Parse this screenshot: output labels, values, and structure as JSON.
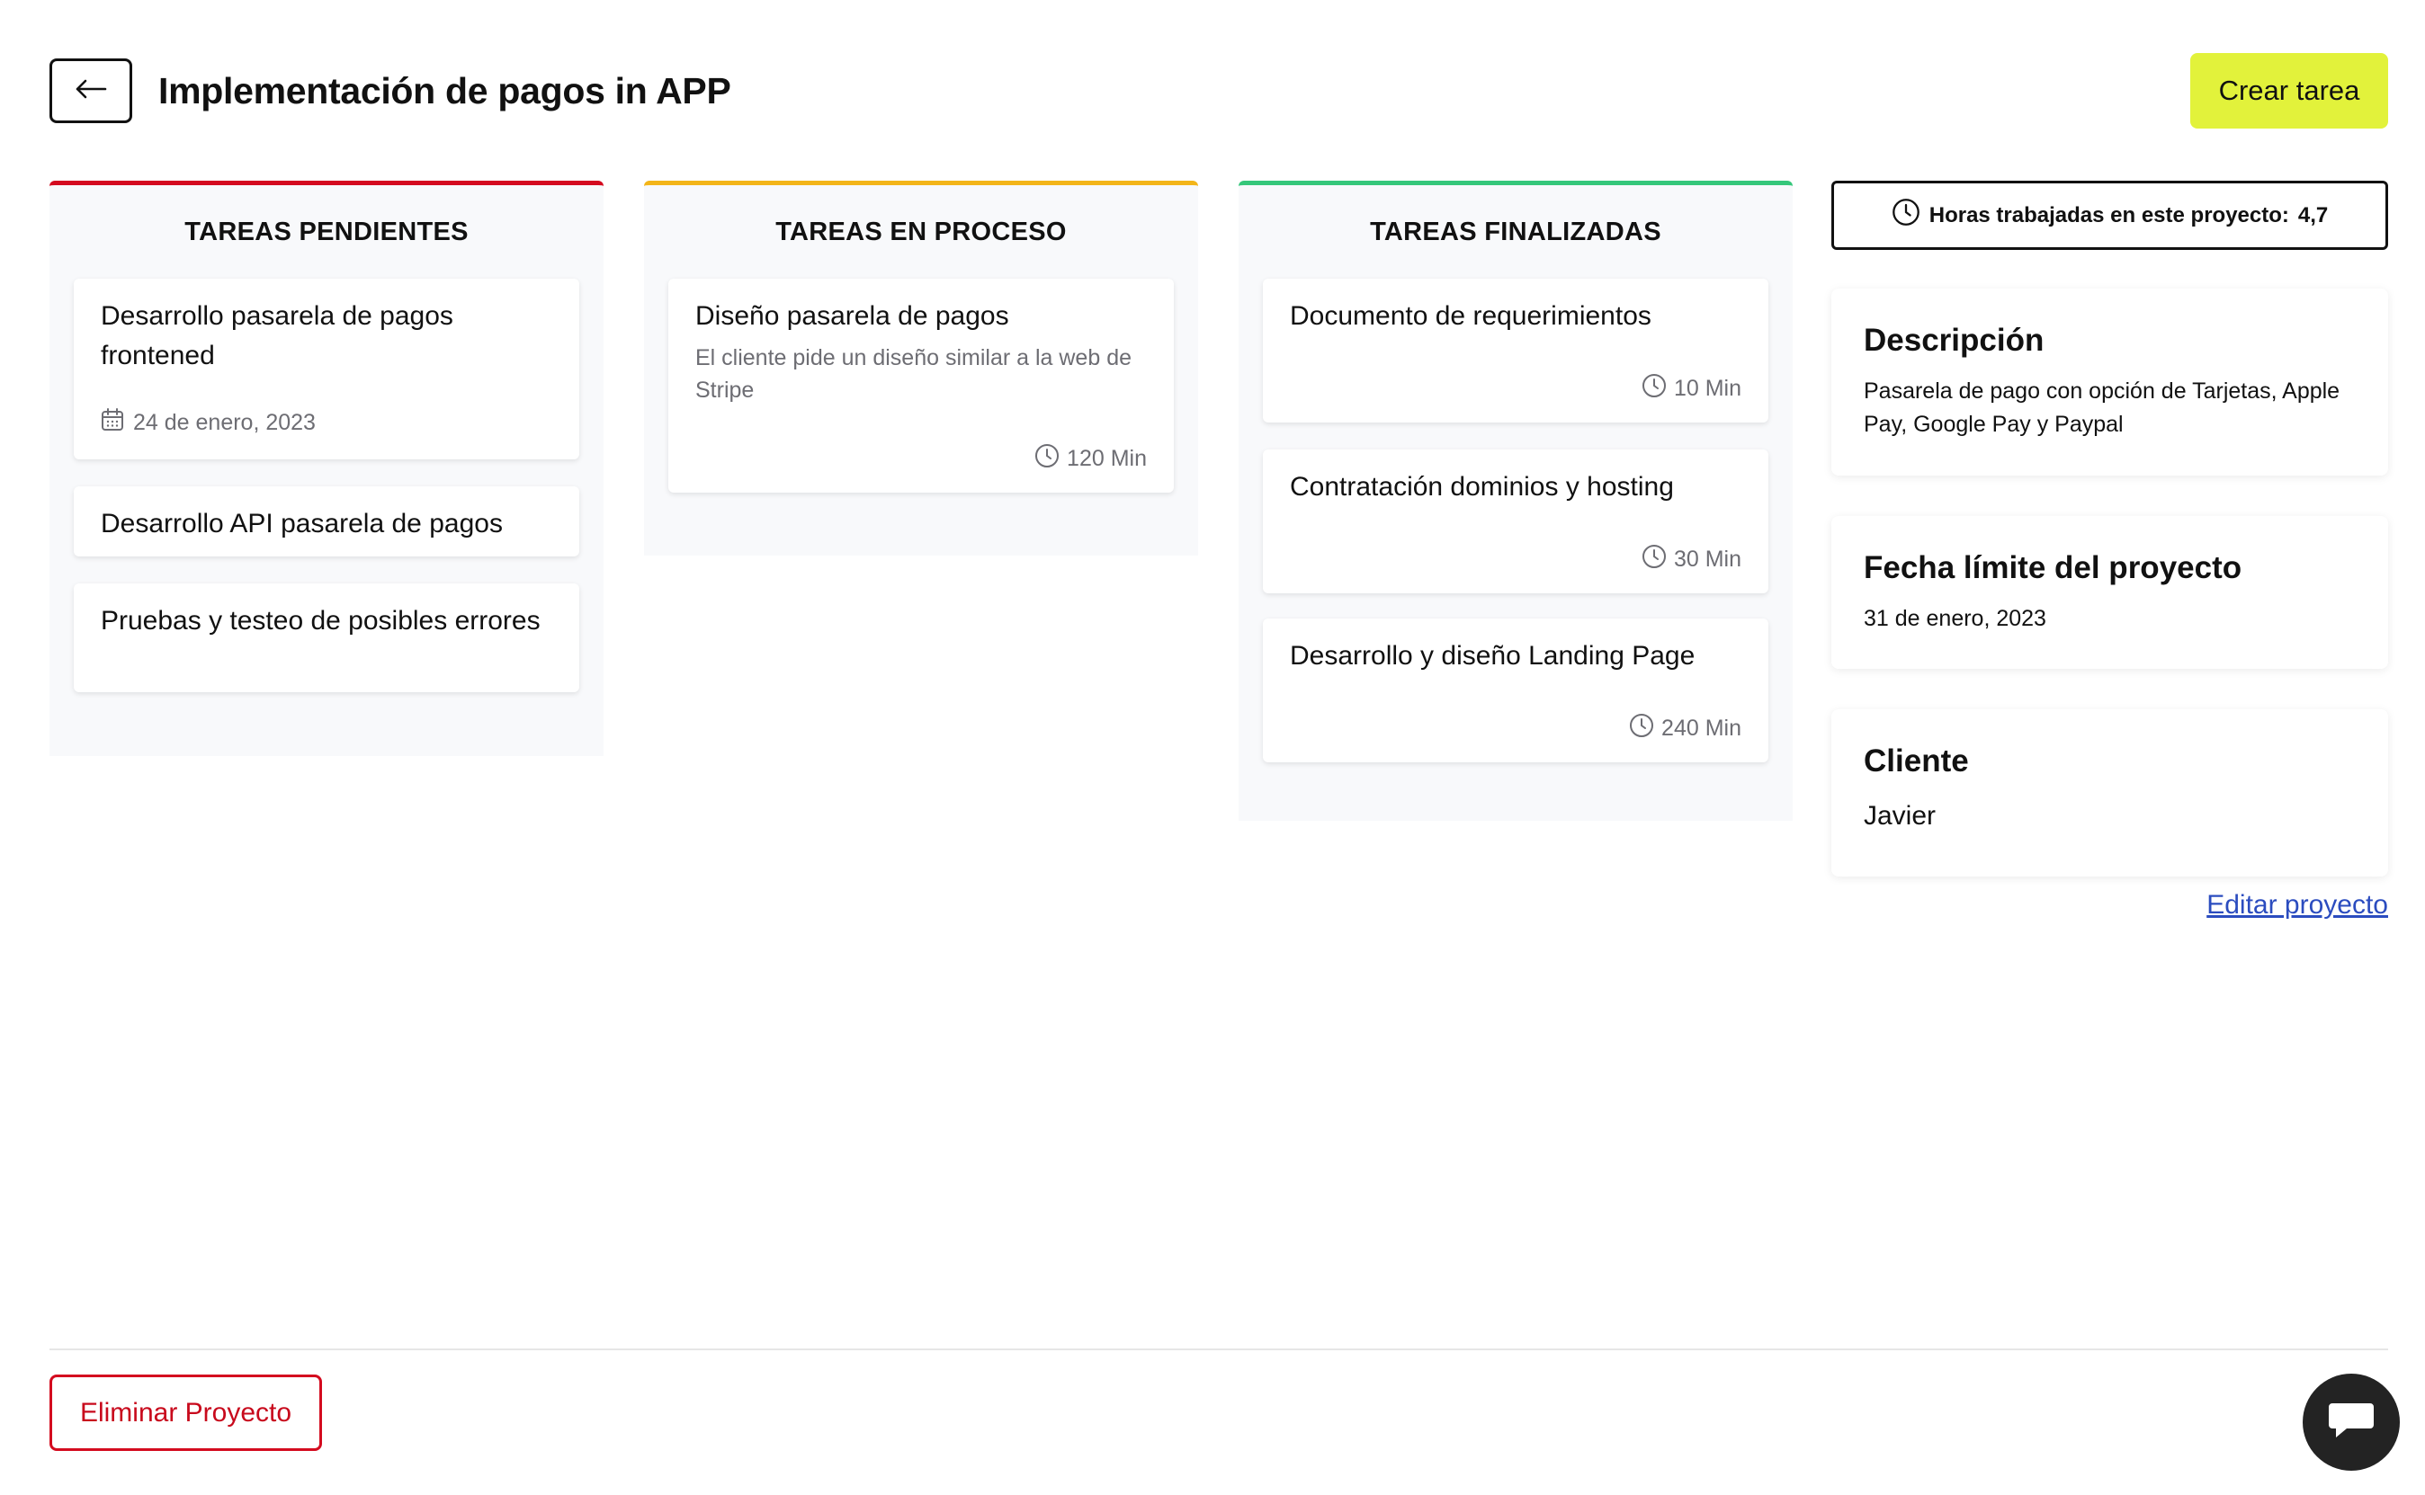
{
  "header": {
    "title": "Implementación de pagos in APP",
    "create_button": "Crear tarea"
  },
  "columns": [
    {
      "title": "TAREAS PENDIENTES",
      "accent": "#d40b1f",
      "tasks": [
        {
          "title": "Desarrollo pasarela de pagos frontened",
          "date": "24 de enero, 2023"
        },
        {
          "title": "Desarrollo API pasarela de pagos"
        },
        {
          "title": "Pruebas y testeo de posibles errores"
        }
      ]
    },
    {
      "title": "TAREAS EN PROCESO",
      "accent": "#f3b519",
      "tasks": [
        {
          "title": "Diseño pasarela de pagos",
          "description": "El cliente pide un diseño similar a la web de Stripe",
          "time": "120 Min"
        }
      ]
    },
    {
      "title": "TAREAS FINALIZADAS",
      "accent": "#35c77a",
      "tasks": [
        {
          "title": "Documento de requerimientos",
          "time": "10 Min"
        },
        {
          "title": "Contratación dominios y hosting",
          "time": "30 Min"
        },
        {
          "title": "Desarrollo y diseño Landing Page",
          "time": "240 Min"
        }
      ]
    }
  ],
  "sidebar": {
    "hours_label": "Horas trabajadas en este proyecto:",
    "hours_value": "4,7",
    "description": {
      "title": "Descripción",
      "text": "Pasarela de pago con opción de Tarjetas, Apple Pay, Google Pay y Paypal"
    },
    "deadline": {
      "title": "Fecha límite del proyecto",
      "text": "31 de enero, 2023"
    },
    "client": {
      "title": "Cliente",
      "text": "Javier"
    },
    "edit_link": "Editar proyecto"
  },
  "footer": {
    "delete_button": "Eliminar Proyecto"
  },
  "icons": {
    "back": "arrow-left-icon",
    "calendar": "calendar-icon",
    "clock": "clock-icon",
    "chat": "chat-bubble-icon"
  },
  "colors": {
    "create_button_bg": "#e2f23b",
    "danger": "#c8091c",
    "link": "#2b4cbf"
  }
}
